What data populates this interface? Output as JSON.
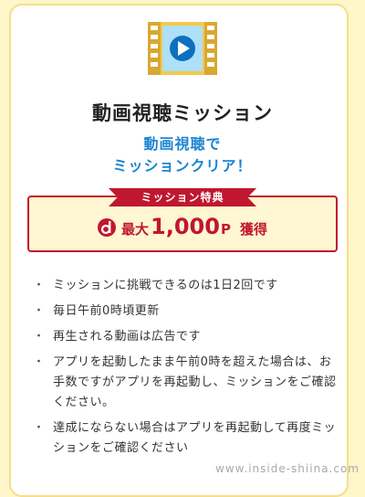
{
  "mission": {
    "title": "動画視聴ミッション",
    "subtitle_line1": "動画視聴で",
    "subtitle_line2": "ミッションクリア！"
  },
  "reward": {
    "ribbon_label": "ミッション特典",
    "prefix": "最大",
    "amount": "1,000",
    "unit": "P",
    "verb": "獲得"
  },
  "notes": [
    "ミッションに挑戦できるのは1日2回です",
    "毎日午前0時頃更新",
    "再生される動画は広告です",
    "アプリを起動したまま午前0時を超えた場合は、お手数ですがアプリを再起動し、ミッションをご確認ください。",
    "達成にならない場合はアプリを再起動して再度ミッションをご確認ください"
  ],
  "watermark": "www.inside-shiina.com",
  "colors": {
    "background": "#fff6c9",
    "accent_red": "#c0172f",
    "accent_blue": "#1c84cf",
    "film": "#f3c94c"
  },
  "icons": {
    "video": "video-film-play-icon",
    "d_point": "d-point-logo-icon"
  }
}
